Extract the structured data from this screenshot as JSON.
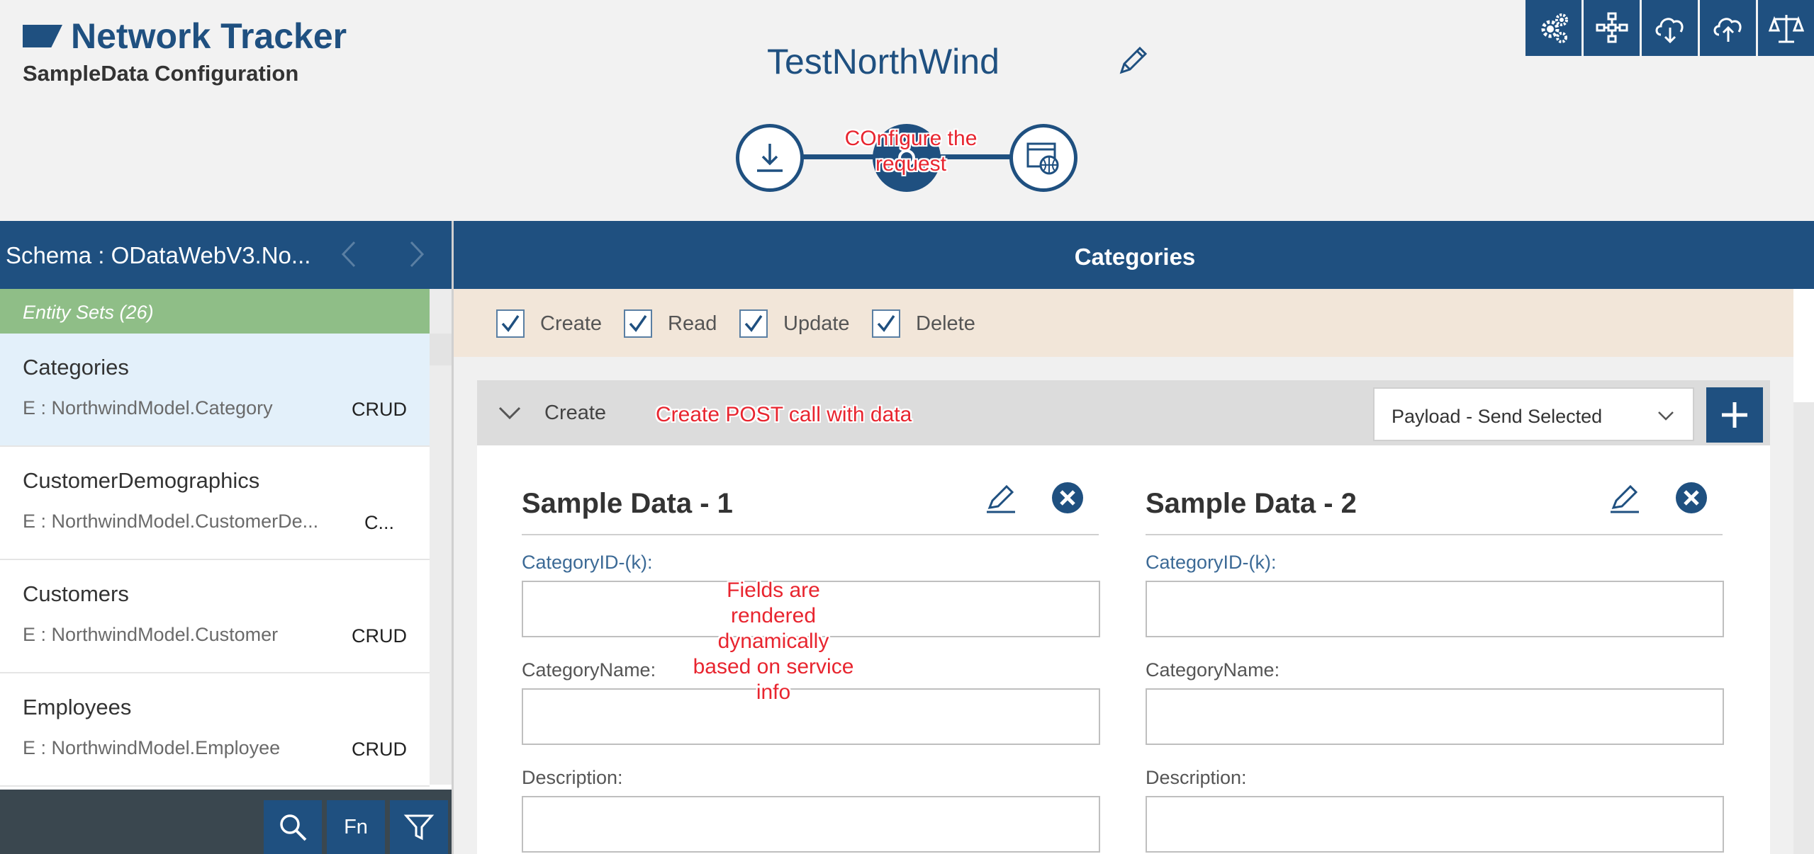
{
  "app": {
    "title": "Network Tracker",
    "subtitle": "SampleData Configuration",
    "project_name": "TestNorthWind",
    "brand_color": "#1f5080"
  },
  "toolbar": {
    "icons": [
      "gears-icon",
      "network-icon",
      "cloud-download-icon",
      "cloud-upload-icon",
      "balance-scale-icon"
    ]
  },
  "stepper": {
    "steps": [
      "download-icon",
      "configure-icon",
      "web-service-icon"
    ],
    "active_step": 2
  },
  "annotations": {
    "step": "COnfigure the request",
    "create": "Create POST call with data",
    "fields": "Fields are rendered dynamically based on service info",
    "color": "#e8252f"
  },
  "sidebar": {
    "schema_title": "Schema : ODataWebV3.No...",
    "entity_header": "Entity Sets (26)",
    "entities": [
      {
        "name": "Categories",
        "type": "E : NorthwindModel.Category",
        "crud": "CRUD"
      },
      {
        "name": "CustomerDemographics",
        "type": "E : NorthwindModel.CustomerDe...",
        "crud": "C..."
      },
      {
        "name": "Customers",
        "type": "E : NorthwindModel.Customer",
        "crud": "CRUD"
      },
      {
        "name": "Employees",
        "type": "E : NorthwindModel.Employee",
        "crud": "CRUD"
      }
    ],
    "bottom_buttons": {
      "fn_label": "Fn"
    }
  },
  "main": {
    "title": "Categories",
    "crud_options": [
      {
        "label": "Create",
        "checked": true
      },
      {
        "label": "Read",
        "checked": true
      },
      {
        "label": "Update",
        "checked": true
      },
      {
        "label": "Delete",
        "checked": true
      }
    ],
    "create_section": {
      "label": "Create",
      "payload_selected": "Payload - Send Selected",
      "samples": [
        {
          "title": "Sample Data - 1",
          "fields": [
            {
              "label": "CategoryID-(k):",
              "value": ""
            },
            {
              "label": "CategoryName:",
              "value": ""
            },
            {
              "label": "Description:",
              "value": ""
            }
          ]
        },
        {
          "title": "Sample Data - 2",
          "fields": [
            {
              "label": "CategoryID-(k):",
              "value": ""
            },
            {
              "label": "CategoryName:",
              "value": ""
            },
            {
              "label": "Description:",
              "value": ""
            }
          ]
        }
      ]
    }
  }
}
